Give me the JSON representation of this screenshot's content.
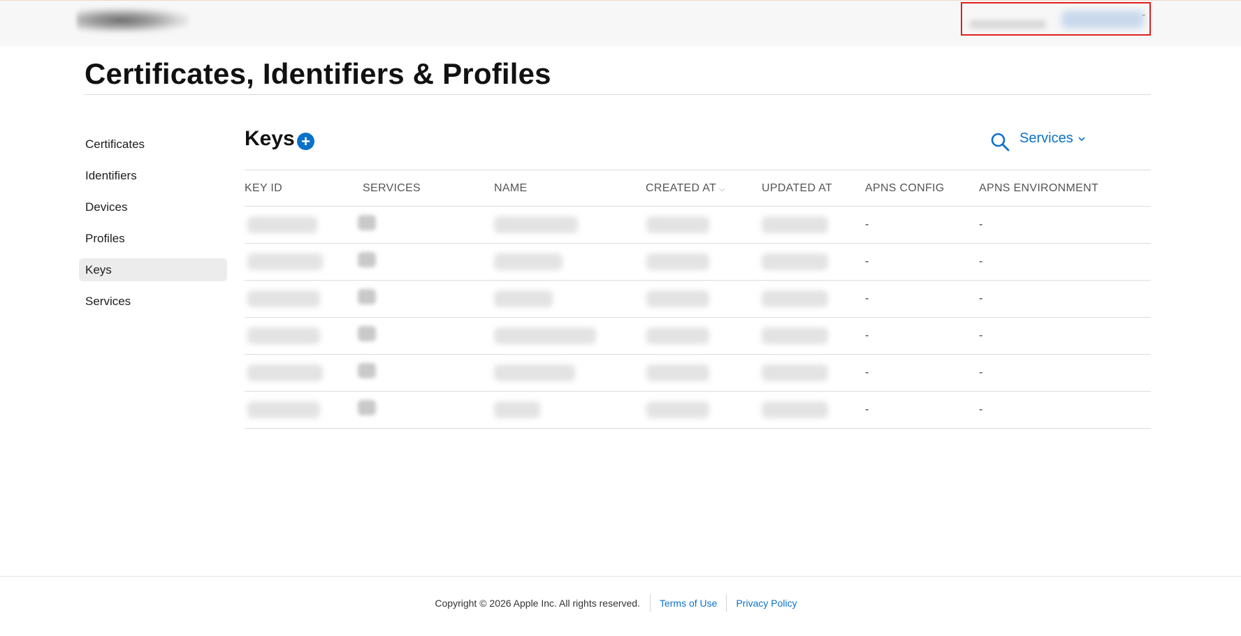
{
  "header": {
    "logo_label": "",
    "account_label": ""
  },
  "page": {
    "title": "Certificates, Identifiers & Profiles"
  },
  "sidebar": {
    "items": [
      {
        "label": "Certificates"
      },
      {
        "label": "Identifiers"
      },
      {
        "label": "Devices"
      },
      {
        "label": "Profiles"
      },
      {
        "label": "Keys",
        "active": true
      },
      {
        "label": "Services"
      }
    ]
  },
  "section": {
    "title": "Keys",
    "add_icon": "plus-circle-icon",
    "search_icon": "search-icon",
    "filter_label": "Services"
  },
  "table": {
    "columns": [
      "KEY ID",
      "SERVICES",
      "NAME",
      "CREATED AT",
      "UPDATED AT",
      "APNS CONFIG",
      "APNS ENVIRONMENT"
    ],
    "sorted_column": "CREATED AT",
    "rows": [
      {
        "apns_config": "-",
        "apns_environment": "-"
      },
      {
        "apns_config": "-",
        "apns_environment": "-"
      },
      {
        "apns_config": "-",
        "apns_environment": "-"
      },
      {
        "apns_config": "-",
        "apns_environment": "-"
      },
      {
        "apns_config": "-",
        "apns_environment": "-"
      },
      {
        "apns_config": "-",
        "apns_environment": "-"
      }
    ]
  },
  "footer": {
    "copyright": "Copyright © 2026 Apple Inc. All rights reserved.",
    "terms_label": "Terms of Use",
    "privacy_label": "Privacy Policy"
  },
  "colors": {
    "accent": "#0a72c9",
    "highlight_box": "#e01f1f",
    "active_sidebar_bg": "#ececec"
  }
}
